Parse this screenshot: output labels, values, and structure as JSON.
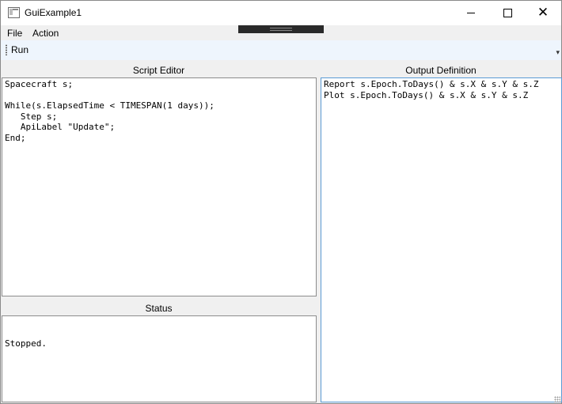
{
  "window": {
    "title": "GuiExample1"
  },
  "title_buttons": {
    "minimize": "minimize",
    "maximize": "maximize",
    "close": "✕"
  },
  "menu": {
    "file": "File",
    "action": "Action"
  },
  "toolbar": {
    "run_label": "Run",
    "overflow": "▾"
  },
  "script_editor": {
    "header": "Script Editor",
    "lines": [
      "Spacecraft s;",
      "",
      "While(s.ElapsedTime < TIMESPAN(1 days));",
      "   Step s;",
      "   ApiLabel \"Update\";",
      "End;"
    ]
  },
  "status": {
    "header": "Status",
    "text": "Stopped."
  },
  "output_definition": {
    "header": "Output Definition",
    "lines": [
      "Report s.Epoch.ToDays() & s.X & s.Y & s.Z",
      "Plot s.Epoch.ToDays() & s.X & s.Y & s.Z"
    ]
  }
}
